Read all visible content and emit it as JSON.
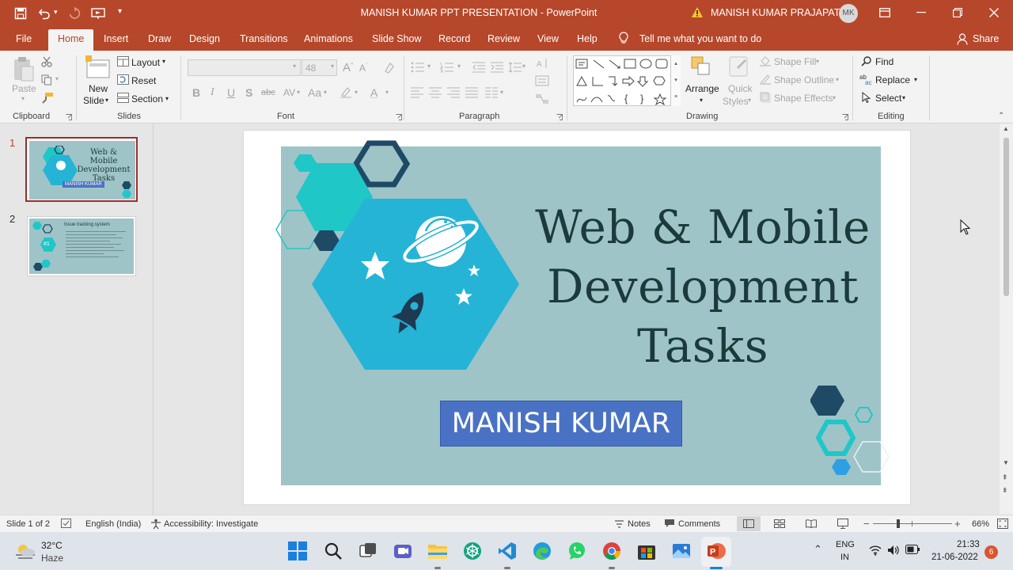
{
  "titlebar": {
    "doc_title": "MANISH KUMAR PPT PRESENTATION",
    "separator": "-",
    "app_name": "PowerPoint",
    "user_name": "MANISH KUMAR PRAJAPATI",
    "user_initials": "MK"
  },
  "tabs": [
    "File",
    "Home",
    "Insert",
    "Draw",
    "Design",
    "Transitions",
    "Animations",
    "Slide Show",
    "Record",
    "Review",
    "View",
    "Help"
  ],
  "tell_me": "Tell me what you want to do",
  "share": "Share",
  "ribbon": {
    "clipboard": {
      "label": "Clipboard",
      "paste": "Paste"
    },
    "slides": {
      "label": "Slides",
      "new_slide_1": "New",
      "new_slide_2": "Slide",
      "layout": "Layout",
      "reset": "Reset",
      "section": "Section"
    },
    "font": {
      "label": "Font",
      "font_size": "48"
    },
    "paragraph": {
      "label": "Paragraph"
    },
    "drawing": {
      "label": "Drawing",
      "arrange": "Arrange",
      "quick_styles_1": "Quick",
      "quick_styles_2": "Styles",
      "shape_fill": "Shape Fill",
      "shape_outline": "Shape Outline",
      "shape_effects": "Shape Effects"
    },
    "editing": {
      "label": "Editing",
      "find": "Find",
      "replace": "Replace",
      "select": "Select"
    }
  },
  "thumbnails": [
    {
      "number": "1",
      "title": "Web & Mobile Development Tasks",
      "name": "MANISH KUMAR"
    },
    {
      "number": "2",
      "title": "Issue tracking system",
      "badge": "#1"
    }
  ],
  "slide": {
    "title_line1": "Web & Mobile",
    "title_line2": "Development",
    "title_line3": "Tasks",
    "name_box": "MANISH KUMAR",
    "colors": {
      "background": "#9ec4c8",
      "title": "#1c3a3c",
      "name_box": "#4a72c4",
      "hex_dark": "#1e4a66",
      "hex_teal": "#1fc7c7"
    }
  },
  "status": {
    "slide_info": "Slide 1 of 2",
    "language": "English (India)",
    "accessibility": "Accessibility: Investigate",
    "notes": "Notes",
    "comments": "Comments",
    "zoom": "66%"
  },
  "taskbar": {
    "temperature": "32°C",
    "weather": "Haze",
    "lang1": "ENG",
    "lang2": "IN",
    "time": "21:33",
    "date": "21-06-2022",
    "notif_count": "6"
  },
  "icons": {
    "save": "save-icon",
    "undo": "undo-icon",
    "redo": "redo-icon",
    "present": "present-from-beginning-icon",
    "warning": "warning-icon",
    "ribbon_display": "ribbon-display-options-icon",
    "lightbulb": "lightbulb-icon",
    "person": "person-icon"
  }
}
